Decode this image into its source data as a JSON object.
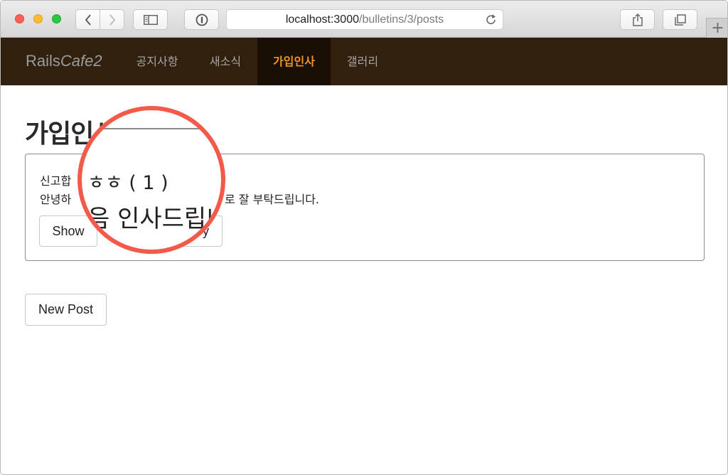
{
  "browser": {
    "url_host": "localhost:3000",
    "url_path": "/bulletins/3/posts",
    "new_tab_symbol": "+"
  },
  "navbar": {
    "brand_prefix": "Rails",
    "brand_suffix": "Cafe2",
    "items": [
      {
        "label": "공지사항",
        "active": false
      },
      {
        "label": "새소식",
        "active": false
      },
      {
        "label": "가입인사",
        "active": true
      },
      {
        "label": "갤러리",
        "active": false
      }
    ],
    "background_color": "#31200e",
    "active_color": "#f6921e"
  },
  "page": {
    "title": "가입인사"
  },
  "post": {
    "title_visible": "신고합",
    "body_visible_start": "안녕하",
    "body_visible_end": "로 잘 부탁드립니다.",
    "show_label": "Show",
    "edit_label_fragment": "y"
  },
  "magnifier": {
    "title_text": "ㅎㅎ ( 1 )",
    "body_text": "음 인사드립니",
    "ring_color": "#f45a4a"
  },
  "actions": {
    "new_post_label": "New Post"
  }
}
